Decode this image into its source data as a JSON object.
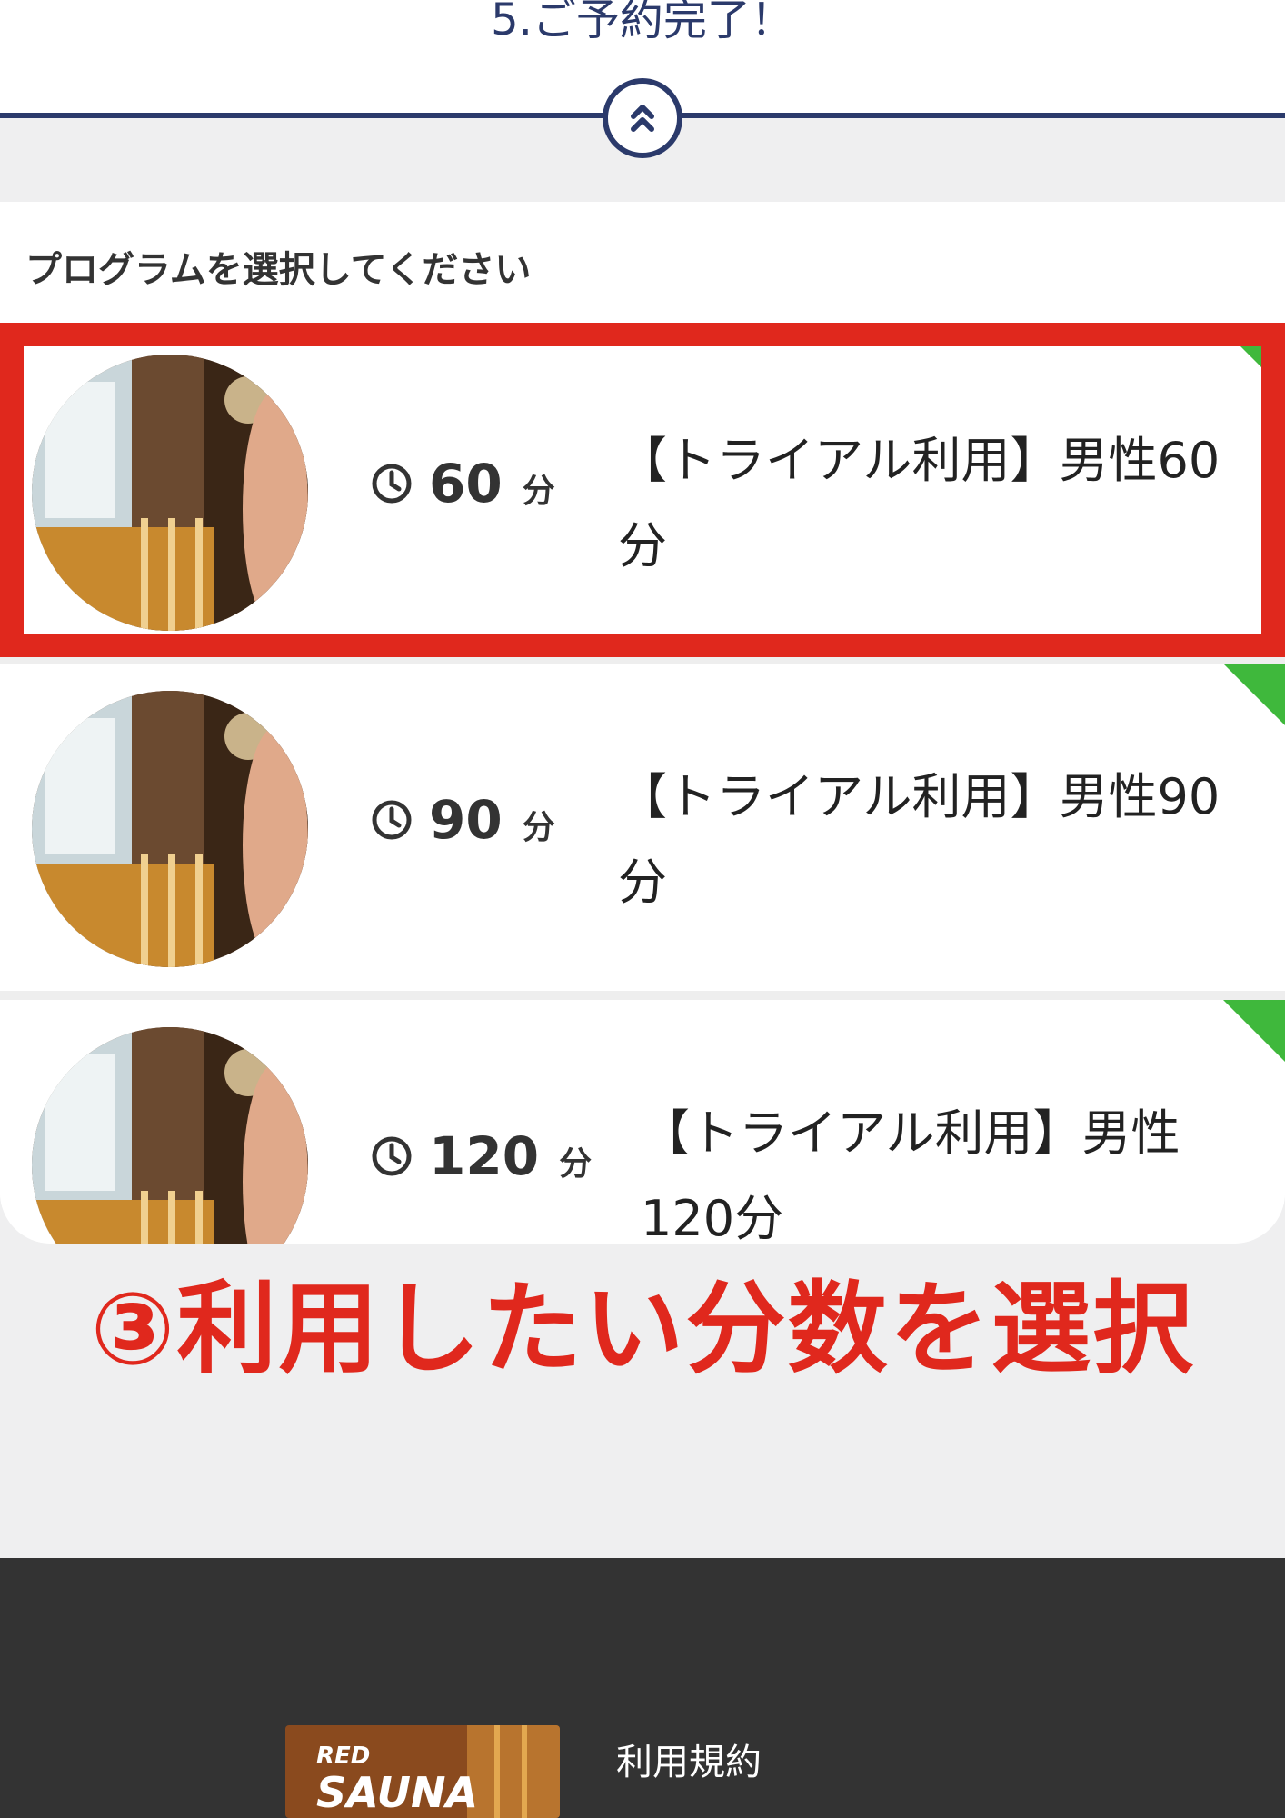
{
  "header": {
    "step_title": "5.ご予約完了！",
    "collapse_icon": "double-chevron-up-icon"
  },
  "program_list": {
    "heading": "プログラムを選択してください",
    "items": [
      {
        "duration": "60",
        "unit": "分",
        "name_line1": "【トライアル利用】男性60",
        "name_line2": "分",
        "selected": true
      },
      {
        "duration": "90",
        "unit": "分",
        "name_line1": "【トライアル利用】男性90",
        "name_line2": "分",
        "selected": false
      },
      {
        "duration": "120",
        "unit": "分",
        "name_line1": "【トライアル利用】男性",
        "name_line2": "120分",
        "selected": false
      }
    ]
  },
  "annotation": {
    "caption": "③利用したい分数を選択",
    "color": "#e0281d"
  },
  "footer": {
    "logo_text": "RED UENO SAUNA",
    "terms_link": "利用規約"
  },
  "colors": {
    "navy": "#2b3a6b",
    "accent_green": "#3fb83c",
    "highlight_red": "#e0281d",
    "footer_bg": "#333333"
  }
}
